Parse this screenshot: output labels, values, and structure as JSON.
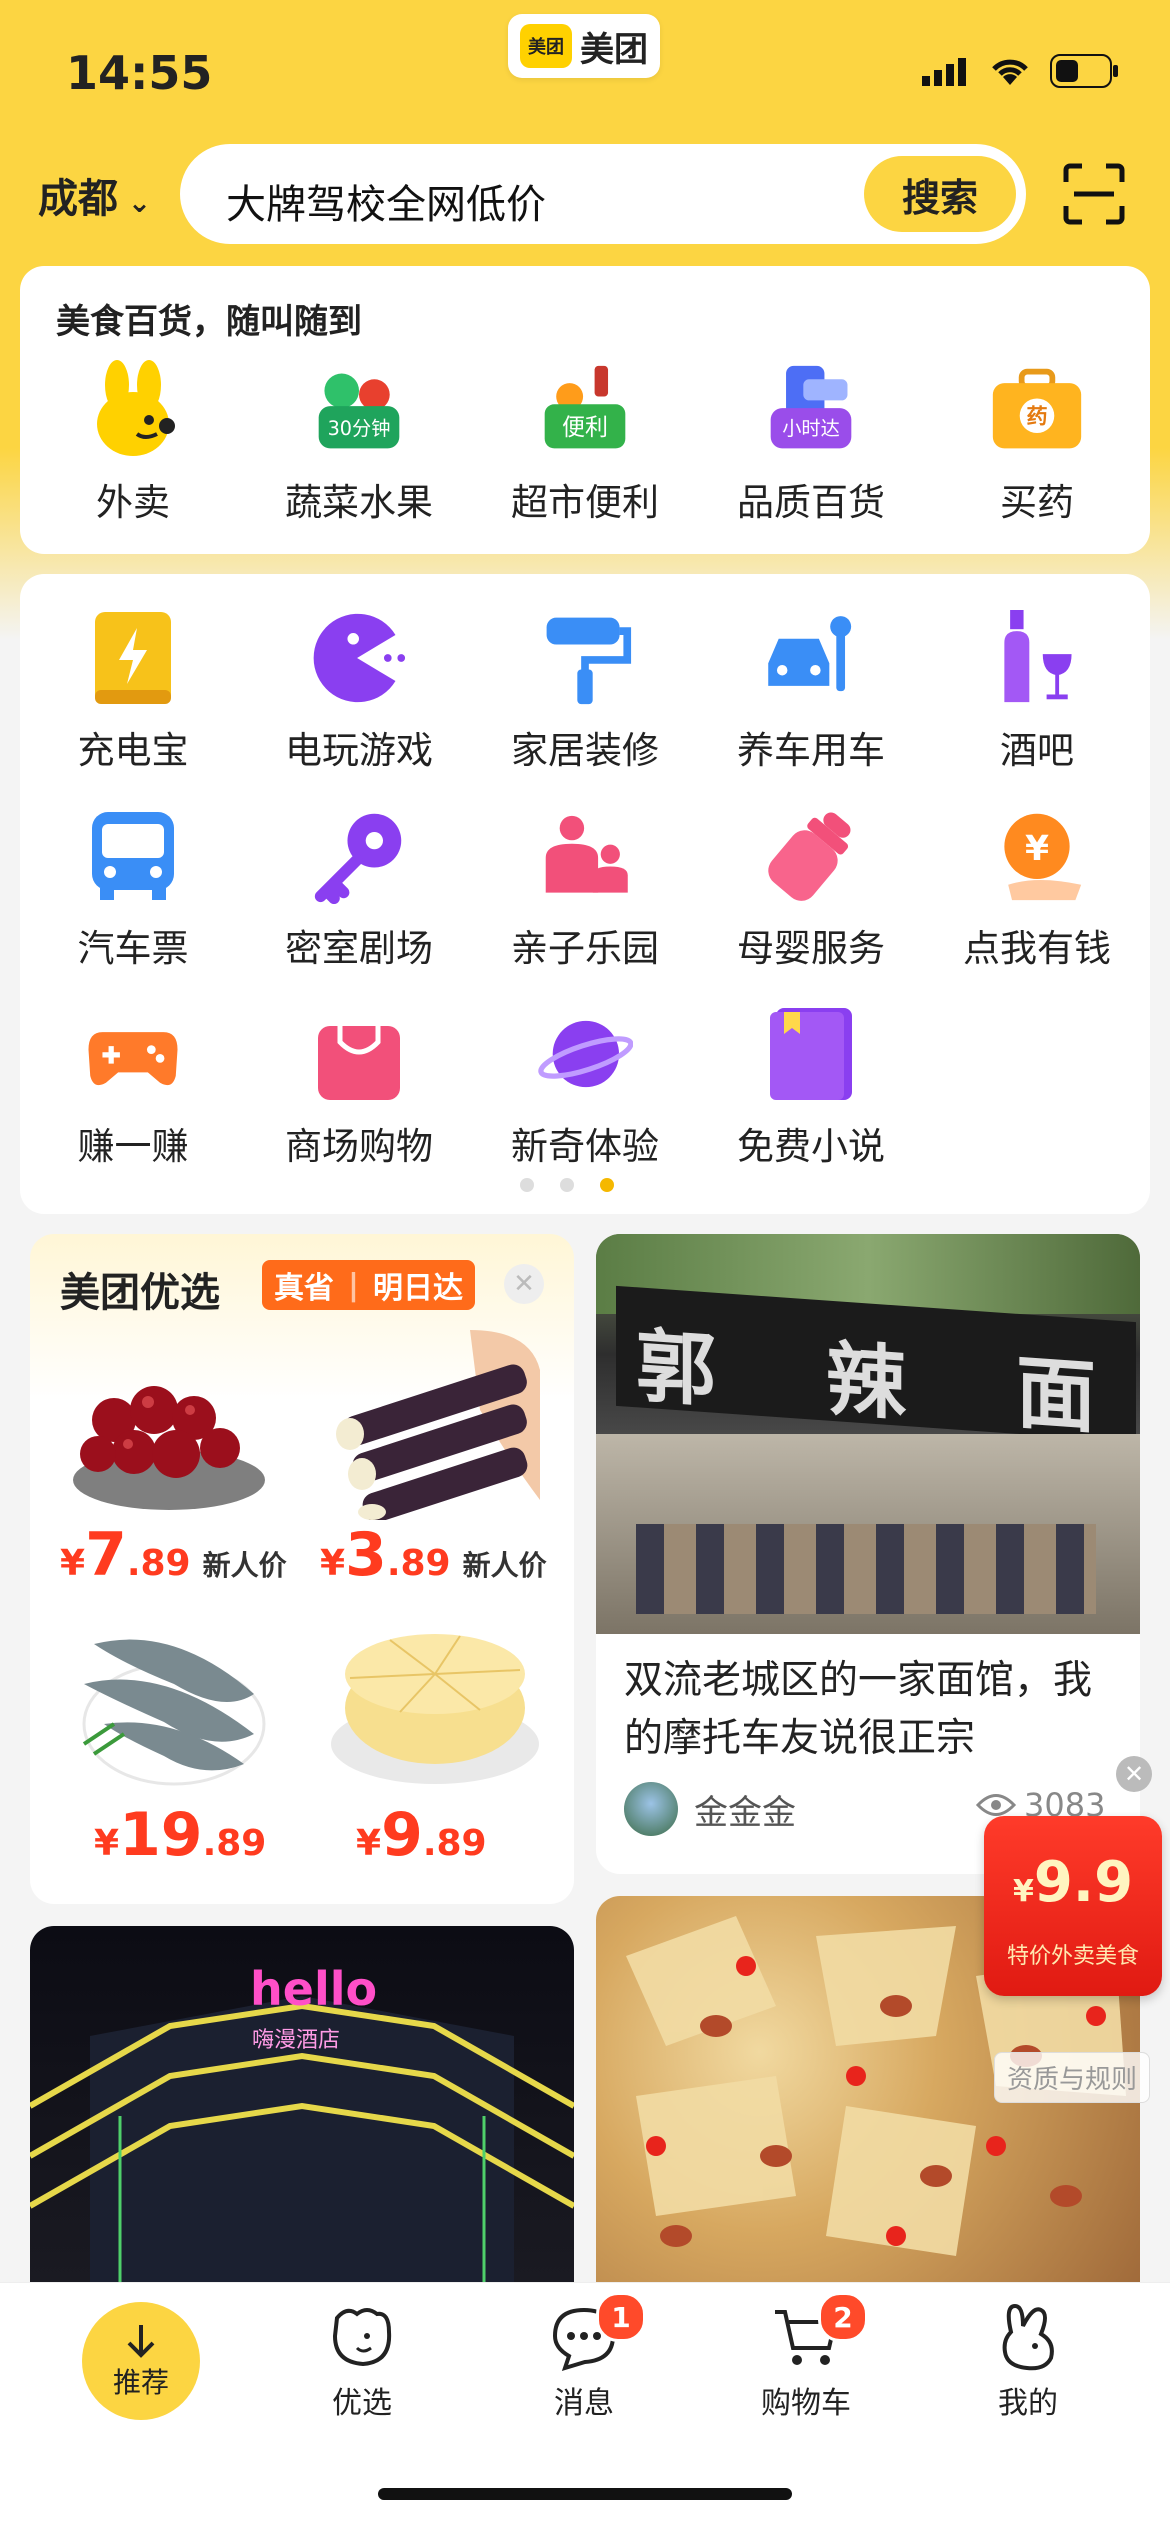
{
  "status": {
    "time": "14:55"
  },
  "brand": {
    "logo_text": "美团",
    "name": "美团"
  },
  "header": {
    "city": "成都",
    "search_placeholder": "大牌驾校全网低价",
    "search_button": "搜索"
  },
  "food_card": {
    "title": "美食百货，随叫随到",
    "items": [
      {
        "label": "外卖",
        "icon": "waimai-mascot-icon"
      },
      {
        "label": "蔬菜水果",
        "icon": "vegetable-fruit-icon",
        "badge": "30分钟"
      },
      {
        "label": "超市便利",
        "icon": "supermarket-basket-icon",
        "badge": "便利"
      },
      {
        "label": "品质百货",
        "icon": "department-store-icon",
        "badge": "小时达"
      },
      {
        "label": "买药",
        "icon": "medicine-box-icon",
        "badge": "药"
      }
    ]
  },
  "services": {
    "rows": [
      [
        {
          "label": "充电宝",
          "icon": "power-bank-icon"
        },
        {
          "label": "电玩游戏",
          "icon": "pacman-icon"
        },
        {
          "label": "家居装修",
          "icon": "paint-roller-icon"
        },
        {
          "label": "养车用车",
          "icon": "car-wrench-icon"
        },
        {
          "label": "酒吧",
          "icon": "wine-icon"
        }
      ],
      [
        {
          "label": "汽车票",
          "icon": "bus-icon"
        },
        {
          "label": "密室剧场",
          "icon": "key-icon"
        },
        {
          "label": "亲子乐园",
          "icon": "parent-child-icon"
        },
        {
          "label": "母婴服务",
          "icon": "baby-bottle-icon"
        },
        {
          "label": "点我有钱",
          "icon": "coin-hand-icon"
        }
      ],
      [
        {
          "label": "赚一赚",
          "icon": "gamepad-icon"
        },
        {
          "label": "商场购物",
          "icon": "shopping-bag-icon"
        },
        {
          "label": "新奇体验",
          "icon": "planet-icon"
        },
        {
          "label": "免费小说",
          "icon": "book-icon"
        }
      ]
    ],
    "page_index": 3,
    "page_count": 3,
    "coin_symbol": "¥"
  },
  "youxuan": {
    "title": "美团优选",
    "tag1": "真省",
    "tag2": "明日达",
    "products": [
      {
        "name": "cherries",
        "currency": "¥",
        "int": "7",
        "dec": ".89",
        "tag": "新人价"
      },
      {
        "name": "sugarcane",
        "currency": "¥",
        "int": "3",
        "dec": ".89",
        "tag": "新人价"
      },
      {
        "name": "shrimp",
        "currency": "¥",
        "int": "19",
        "dec": ".89",
        "tag": ""
      },
      {
        "name": "durian-cake",
        "currency": "¥",
        "int": "9",
        "dec": ".89",
        "tag": ""
      }
    ]
  },
  "post": {
    "title": "双流老城区的一家面馆，我的摩托车友说很正宗",
    "author": "金金金",
    "views": "3083",
    "sign_chars": [
      "郭",
      "辣",
      "面"
    ]
  },
  "hotel": {
    "sign": "hello",
    "sub": "嗨漫酒店"
  },
  "promo": {
    "currency": "¥",
    "value": "9.9",
    "subtitle": "特价外卖美食",
    "rules": "资质与规则"
  },
  "tabbar": {
    "items": [
      {
        "label": "推荐"
      },
      {
        "label": "优选"
      },
      {
        "label": "消息",
        "badge": "1"
      },
      {
        "label": "购物车",
        "badge": "2"
      },
      {
        "label": "我的"
      }
    ]
  },
  "colors": {
    "brand_yellow": "#fcd542",
    "price_red": "#ff3b1f",
    "badge_red": "#ff4a2a"
  }
}
